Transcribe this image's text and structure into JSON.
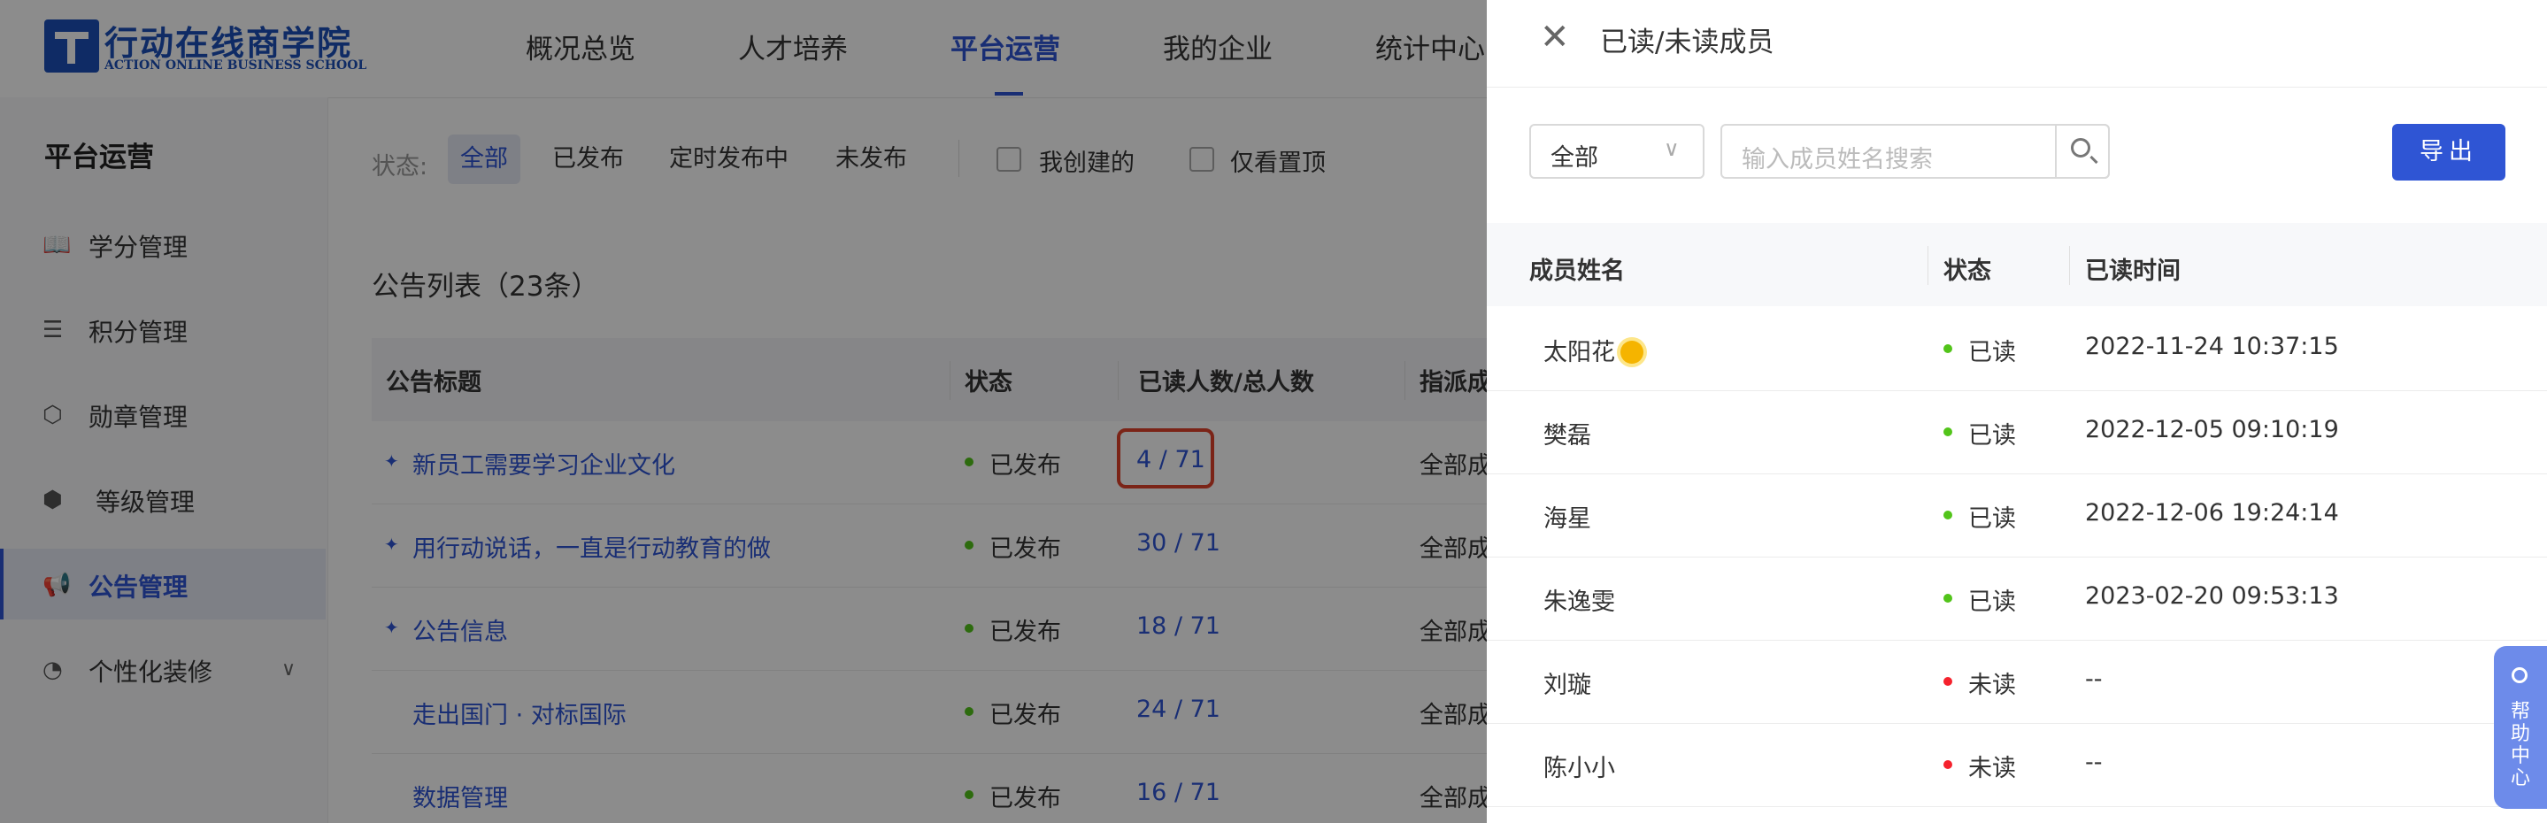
{
  "logo": {
    "title": "行动在线商学院",
    "subtitle": "ACTION ONLINE BUSINESS SCHOOL"
  },
  "topnav": {
    "items": [
      "概况总览",
      "人才培养",
      "平台运营",
      "我的企业",
      "统计中心"
    ],
    "active": "平台运营"
  },
  "sidebar": {
    "title": "平台运营",
    "items": [
      {
        "label": "学分管理",
        "icon": "book-icon"
      },
      {
        "label": "积分管理",
        "icon": "database-icon"
      },
      {
        "label": "勋章管理",
        "icon": "medal-icon"
      },
      {
        "label": "等级管理",
        "icon": "level-shield-icon"
      },
      {
        "label": "公告管理",
        "icon": "megaphone-icon"
      },
      {
        "label": "个性化装修",
        "icon": "palette-icon"
      }
    ],
    "active": "公告管理"
  },
  "filter": {
    "status_label": "状态:",
    "chips": [
      "全部",
      "已发布",
      "定时发布中",
      "未发布"
    ],
    "checkboxes": [
      "我创建的",
      "仅看置顶"
    ]
  },
  "list": {
    "title": "公告列表（23条）",
    "columns": [
      "公告标题",
      "状态",
      "已读人数/总人数",
      "指派成"
    ],
    "rows": [
      {
        "title": "新员工需要学习企业文化",
        "pinned": true,
        "status": "已发布",
        "ratio": "4 / 71",
        "assign": "全部成"
      },
      {
        "title": "用行动说话，一直是行动教育的做",
        "pinned": true,
        "status": "已发布",
        "ratio": "30 / 71",
        "assign": "全部成"
      },
      {
        "title": "公告信息",
        "pinned": true,
        "status": "已发布",
        "ratio": "18 / 71",
        "assign": "全部成"
      },
      {
        "title": "走出国门 · 对标国际",
        "pinned": false,
        "status": "已发布",
        "ratio": "24 / 71",
        "assign": "全部成"
      },
      {
        "title": "数据管理",
        "pinned": false,
        "status": "已发布",
        "ratio": "16 / 71",
        "assign": "全部成"
      }
    ]
  },
  "drawer": {
    "title": "已读/未读成员",
    "filter_value": "全部",
    "search_placeholder": "输入成员姓名搜索",
    "export_label": "导出",
    "columns": [
      "成员姓名",
      "状态",
      "已读时间"
    ],
    "rows": [
      {
        "name": "太阳花",
        "emoji": true,
        "status": "已读",
        "read": true,
        "time": "2022-11-24 10:37:15"
      },
      {
        "name": "樊磊",
        "emoji": false,
        "status": "已读",
        "read": true,
        "time": "2022-12-05 09:10:19"
      },
      {
        "name": "海星",
        "emoji": false,
        "status": "已读",
        "read": true,
        "time": "2022-12-06 19:24:14"
      },
      {
        "name": "朱逸雯",
        "emoji": false,
        "status": "已读",
        "read": true,
        "time": "2023-02-20 09:53:13"
      },
      {
        "name": "刘璇",
        "emoji": false,
        "status": "未读",
        "read": false,
        "time": "--"
      },
      {
        "name": "陈小小",
        "emoji": false,
        "status": "未读",
        "read": false,
        "time": "--"
      }
    ]
  },
  "help": {
    "label": "帮助中心"
  },
  "colors": {
    "primary": "#2f55d4",
    "read_dot": "#52c41a",
    "unread_dot": "#f5222d",
    "highlight": "#e0432b"
  }
}
